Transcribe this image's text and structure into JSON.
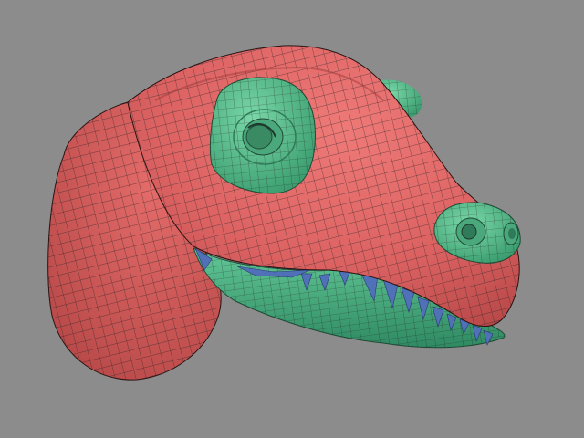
{
  "viewport": {
    "background": "#8c8c8c"
  },
  "model": {
    "subject": "dinosaur-head",
    "style": "quad-mesh-wireframe",
    "colors": {
      "head_region": "#e06464",
      "head_region_shadow": "#b84848",
      "eye_and_nostril_region": "#58c08c",
      "jaw_region": "#4eb888",
      "jaw_region_shadow": "#2f8a62",
      "teeth": "#5070b8",
      "wire": "#1e1e1e"
    }
  }
}
